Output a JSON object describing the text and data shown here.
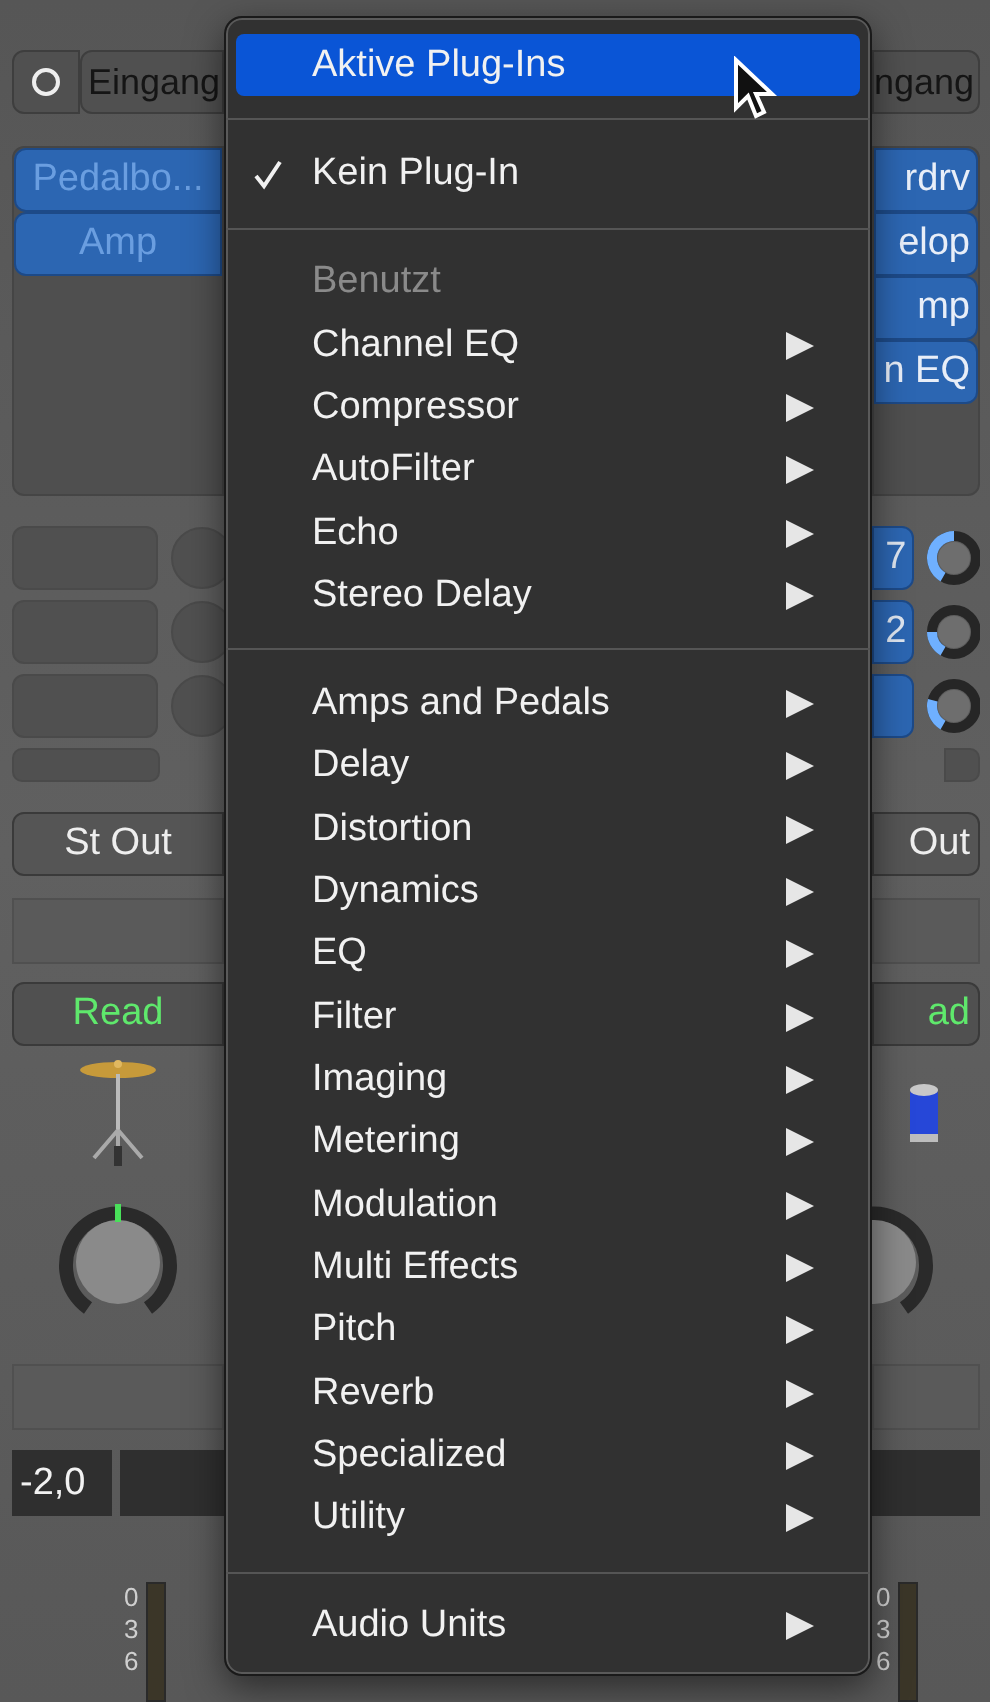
{
  "channel_strips": [
    {
      "input": "Eingang",
      "plugins": [
        "Pedalbo...",
        "Amp"
      ],
      "sends": [
        {
          "active": false
        },
        {
          "active": false
        },
        {
          "active": false
        }
      ],
      "output": "St Out",
      "automation": "Read",
      "volume": "-2,0",
      "meter_scale": [
        "0",
        "3",
        "6"
      ]
    },
    {
      "input": "ngang",
      "plugins": [
        "rdrv",
        "elop",
        "mp",
        "n EQ"
      ],
      "sends": [
        {
          "active": true,
          "label": "7",
          "level": 0.5
        },
        {
          "active": true,
          "label": "2",
          "level": 0.2
        },
        {
          "active": true,
          "level": 0.25
        }
      ],
      "output": "Out",
      "automation": "ad",
      "meter_scale": [
        "0",
        "3",
        "6"
      ]
    }
  ],
  "menu": {
    "items": [
      {
        "kind": "item",
        "label": "Aktive Plug-Ins",
        "selected": true,
        "checked": false,
        "submenu": false
      },
      {
        "kind": "separator"
      },
      {
        "kind": "item",
        "label": "Kein Plug-In",
        "selected": false,
        "checked": true,
        "submenu": false
      },
      {
        "kind": "separator"
      },
      {
        "kind": "header",
        "label": "Benutzt"
      },
      {
        "kind": "item",
        "label": "Channel EQ",
        "selected": false,
        "checked": false,
        "submenu": true
      },
      {
        "kind": "item",
        "label": "Compressor",
        "selected": false,
        "checked": false,
        "submenu": true
      },
      {
        "kind": "item",
        "label": "AutoFilter",
        "selected": false,
        "checked": false,
        "submenu": true
      },
      {
        "kind": "item",
        "label": "Echo",
        "selected": false,
        "checked": false,
        "submenu": true
      },
      {
        "kind": "item",
        "label": "Stereo Delay",
        "selected": false,
        "checked": false,
        "submenu": true
      },
      {
        "kind": "separator"
      },
      {
        "kind": "item",
        "label": "Amps and Pedals",
        "selected": false,
        "checked": false,
        "submenu": true
      },
      {
        "kind": "item",
        "label": "Delay",
        "selected": false,
        "checked": false,
        "submenu": true
      },
      {
        "kind": "item",
        "label": "Distortion",
        "selected": false,
        "checked": false,
        "submenu": true
      },
      {
        "kind": "item",
        "label": "Dynamics",
        "selected": false,
        "checked": false,
        "submenu": true
      },
      {
        "kind": "item",
        "label": "EQ",
        "selected": false,
        "checked": false,
        "submenu": true
      },
      {
        "kind": "item",
        "label": "Filter",
        "selected": false,
        "checked": false,
        "submenu": true
      },
      {
        "kind": "item",
        "label": "Imaging",
        "selected": false,
        "checked": false,
        "submenu": true
      },
      {
        "kind": "item",
        "label": "Metering",
        "selected": false,
        "checked": false,
        "submenu": true
      },
      {
        "kind": "item",
        "label": "Modulation",
        "selected": false,
        "checked": false,
        "submenu": true
      },
      {
        "kind": "item",
        "label": "Multi Effects",
        "selected": false,
        "checked": false,
        "submenu": true
      },
      {
        "kind": "item",
        "label": "Pitch",
        "selected": false,
        "checked": false,
        "submenu": true
      },
      {
        "kind": "item",
        "label": "Reverb",
        "selected": false,
        "checked": false,
        "submenu": true
      },
      {
        "kind": "item",
        "label": "Specialized",
        "selected": false,
        "checked": false,
        "submenu": true
      },
      {
        "kind": "item",
        "label": "Utility",
        "selected": false,
        "checked": false,
        "submenu": true
      },
      {
        "kind": "separator"
      },
      {
        "kind": "item",
        "label": "Audio Units",
        "selected": false,
        "checked": false,
        "submenu": true
      }
    ]
  }
}
